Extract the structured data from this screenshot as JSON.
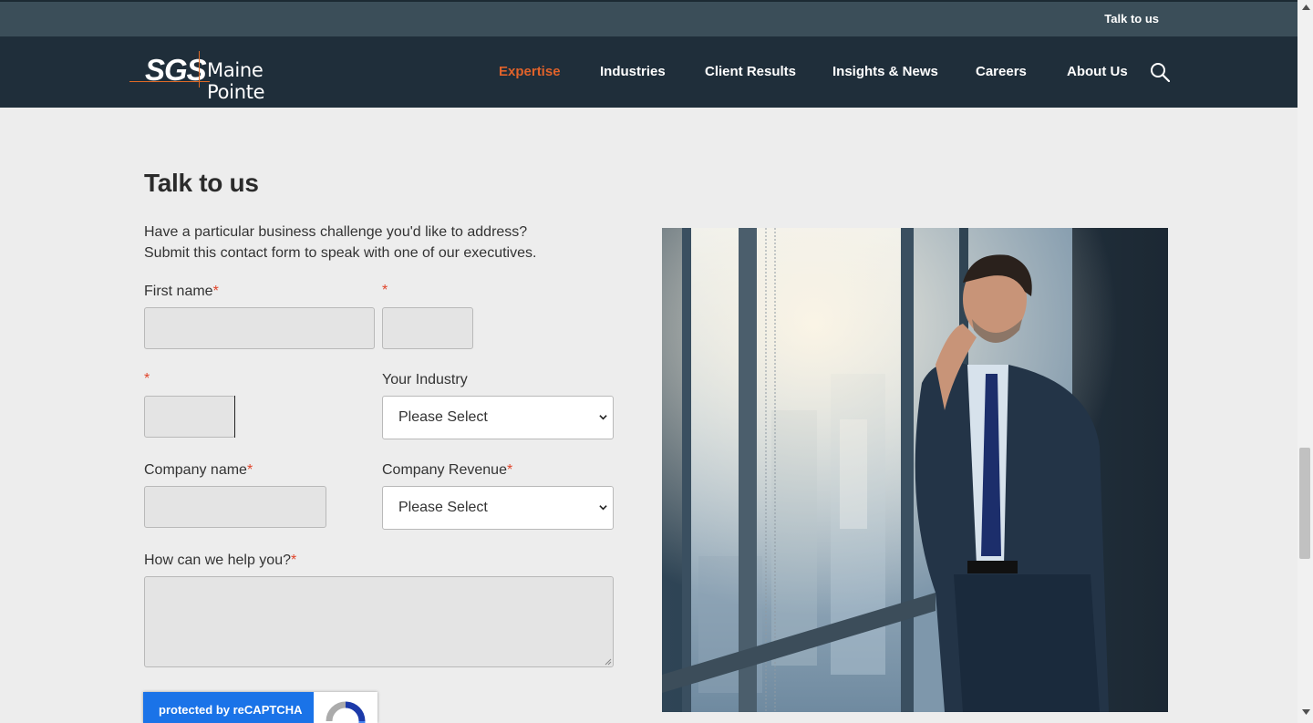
{
  "topbar": {
    "talk_link": "Talk to us"
  },
  "logo": {
    "sgs": "SGS",
    "name": "Maine Pointe"
  },
  "nav": {
    "items": [
      {
        "label": "Expertise",
        "active": true
      },
      {
        "label": "Industries"
      },
      {
        "label": "Client Results"
      },
      {
        "label": "Insights & News"
      },
      {
        "label": "Careers"
      },
      {
        "label": "About Us"
      }
    ],
    "search_icon": "search-icon"
  },
  "main": {
    "title": "Talk to us",
    "intro_line1": "Have a particular business challenge you'd like to address?",
    "intro_line2": "Submit this contact form to speak with one of our executives."
  },
  "form": {
    "first_name_label": "First name",
    "required_mark": "*",
    "industry_label": "Your Industry",
    "industry_value": "Please Select",
    "company_name_label": "Company name",
    "company_revenue_label": "Company Revenue",
    "revenue_value": "Please Select",
    "help_label": "How can we help you?"
  },
  "recaptcha": {
    "label": "protected by reCAPTCHA"
  },
  "colors": {
    "accent": "#e0622a",
    "nav_bg": "#1f2e3a",
    "topbar_bg": "#3b4e59",
    "required": "#e0442a",
    "recaptcha_blue": "#1a73e8"
  }
}
